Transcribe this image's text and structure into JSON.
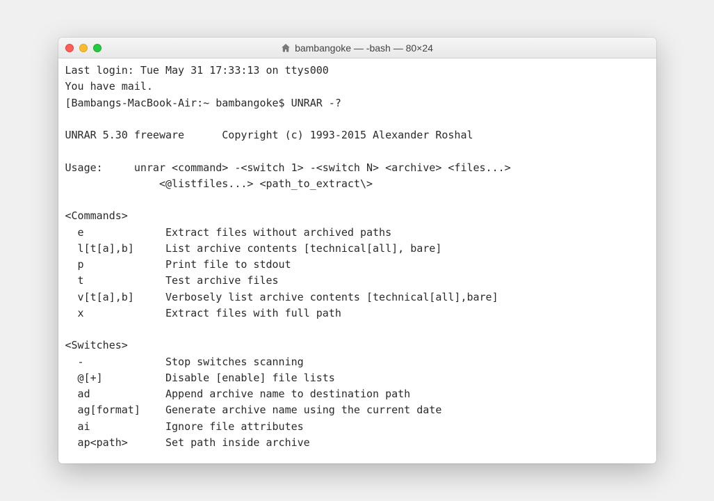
{
  "window": {
    "title": "bambangoke — -bash — 80×24"
  },
  "terminal": {
    "lines": [
      "Last login: Tue May 31 17:33:13 on ttys000",
      "You have mail.",
      "[Bambangs-MacBook-Air:~ bambangoke$ UNRAR -?",
      "",
      "UNRAR 5.30 freeware      Copyright (c) 1993-2015 Alexander Roshal",
      "",
      "Usage:     unrar <command> -<switch 1> -<switch N> <archive> <files...>",
      "               <@listfiles...> <path_to_extract\\>",
      "",
      "<Commands>",
      "  e             Extract files without archived paths",
      "  l[t[a],b]     List archive contents [technical[all], bare]",
      "  p             Print file to stdout",
      "  t             Test archive files",
      "  v[t[a],b]     Verbosely list archive contents [technical[all],bare]",
      "  x             Extract files with full path",
      "",
      "<Switches>",
      "  -             Stop switches scanning",
      "  @[+]          Disable [enable] file lists",
      "  ad            Append archive name to destination path",
      "  ag[format]    Generate archive name using the current date",
      "  ai            Ignore file attributes",
      "  ap<path>      Set path inside archive"
    ]
  }
}
